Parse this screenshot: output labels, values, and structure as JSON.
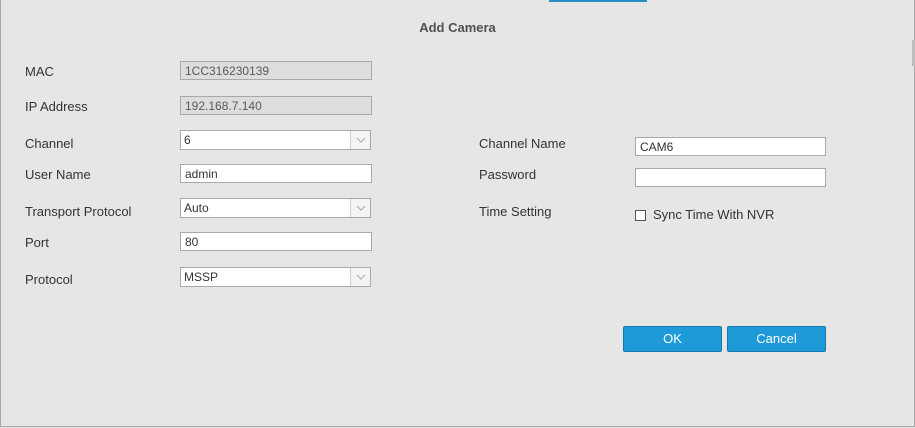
{
  "dialog": {
    "title": "Add Camera",
    "fields": {
      "mac": {
        "label": "MAC",
        "value": "1CC316230139"
      },
      "ip": {
        "label": "IP Address",
        "value": "192.168.7.140"
      },
      "channel": {
        "label": "Channel",
        "value": "6"
      },
      "user_name": {
        "label": "User Name",
        "value": "admin"
      },
      "transport_protocol": {
        "label": "Transport Protocol",
        "value": "Auto"
      },
      "port": {
        "label": "Port",
        "value": "80"
      },
      "protocol": {
        "label": "Protocol",
        "value": "MSSP"
      },
      "channel_name": {
        "label": "Channel Name",
        "value": "CAM6"
      },
      "password": {
        "label": "Password",
        "value": ""
      },
      "time_setting": {
        "label": "Time Setting",
        "checkbox_label": "Sync Time With NVR",
        "checked": false
      }
    },
    "buttons": {
      "ok": "OK",
      "cancel": "Cancel"
    }
  },
  "colors": {
    "accent": "#1f9ad8",
    "background": "#e6e6e6"
  },
  "icons": {
    "dropdown": "chevron-down-icon"
  }
}
